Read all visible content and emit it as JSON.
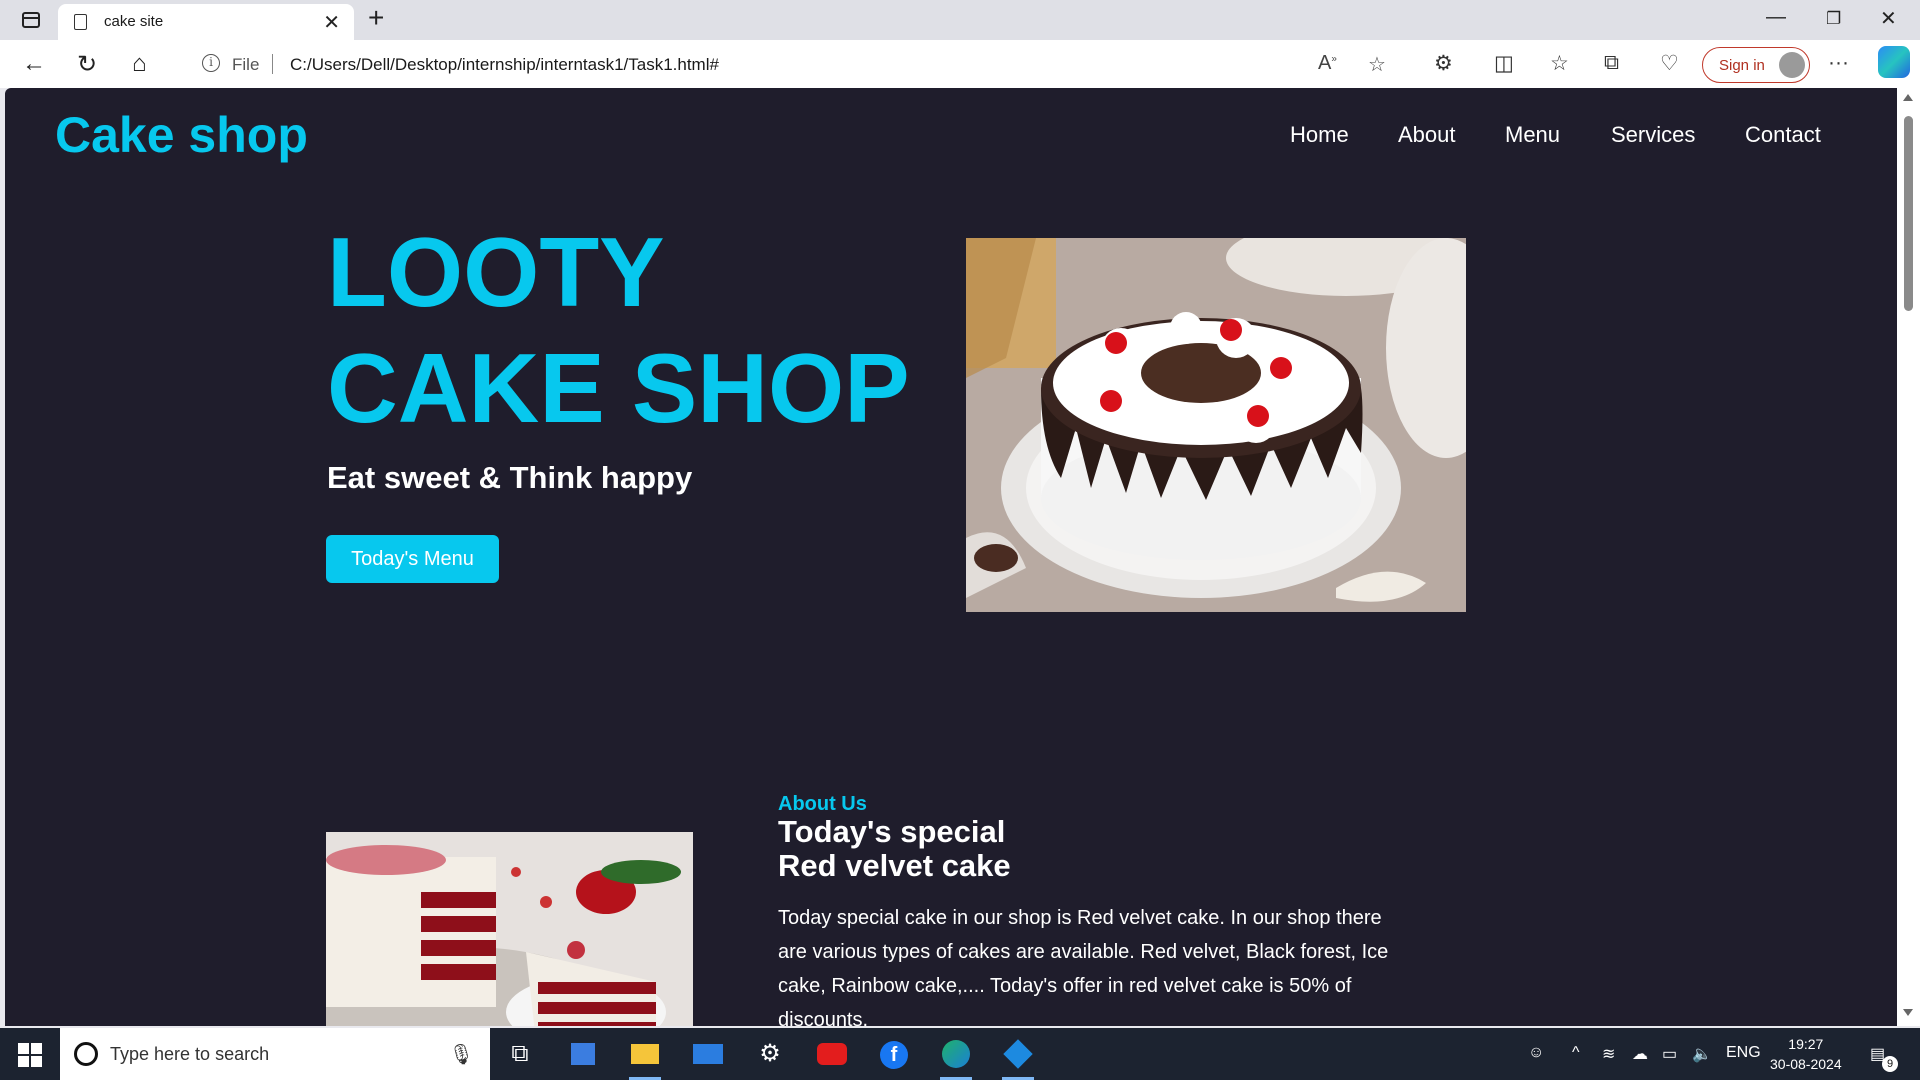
{
  "browser": {
    "tab_title": "cake site",
    "address_prefix": "File",
    "url": "C:/Users/Dell/Desktop/internship/interntask1/Task1.html#",
    "signin_label": "Sign in"
  },
  "site": {
    "brand": "Cake shop",
    "nav": [
      "Home",
      "About",
      "Menu",
      "Services",
      "Contact"
    ],
    "hero": {
      "title_line1": "LOOTY",
      "title_line2": "CAKE SHOP",
      "subtitle": "Eat sweet & Think happy",
      "button": "Today's Menu"
    },
    "about": {
      "label": "About Us",
      "heading_line1": "Today's special",
      "heading_line2": "Red velvet cake",
      "text": "Today special cake in our shop is Red velvet cake. In our shop there are various types of cakes are available. Red velvet, Black forest, Ice cake, Rainbow cake,.... Today's offer in red velvet cake is 50% of discounts."
    }
  },
  "taskbar": {
    "search_placeholder": "Type here to search",
    "language": "ENG",
    "time": "19:27",
    "date": "30-08-2024",
    "notification_count": "9"
  },
  "colors": {
    "accent": "#07c8ee",
    "page_bg": "#1f1d2c",
    "taskbar_bg": "#1c2330"
  },
  "icons": [
    "tab-actions-icon",
    "page-icon",
    "close-icon",
    "plus-icon",
    "minimize-icon",
    "restore-icon",
    "back-icon",
    "refresh-icon",
    "home-icon",
    "info-icon",
    "read-aloud-icon",
    "star-icon",
    "extensions-icon",
    "split-screen-icon",
    "favorites-icon",
    "collections-icon",
    "performance-icon",
    "more-icon",
    "copilot-icon",
    "windows-icon",
    "search-icon",
    "mic-icon",
    "task-view-icon",
    "store-icon",
    "file-explorer-icon",
    "mail-icon",
    "settings-icon",
    "youtube-icon",
    "facebook-icon",
    "edge-icon",
    "vscode-icon",
    "wifi-icon",
    "onedrive-icon",
    "battery-icon",
    "volume-icon",
    "notification-icon"
  ]
}
